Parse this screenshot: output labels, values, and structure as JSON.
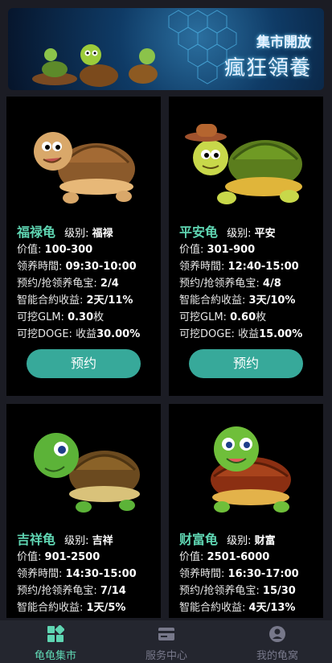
{
  "banner": {
    "line1": "集市開放",
    "line2": "瘋狂領養"
  },
  "cards": [
    {
      "name": "福禄龟",
      "level_label": "级别:",
      "level": "福禄",
      "rows": [
        {
          "label": "价值:",
          "value": "100-300"
        },
        {
          "label": "领养時間:",
          "value": "09:30-10:00"
        },
        {
          "label": "预约/抢领养龟宝:",
          "value": "2/4"
        },
        {
          "label": "智能合約收益:",
          "value": "2天/11%"
        },
        {
          "label": "可挖GLM:",
          "value": "0.30",
          "suffix": "枚"
        },
        {
          "label": "可挖DOGE:",
          "value": "30.00%",
          "prefix": "收益"
        }
      ],
      "button": "预约"
    },
    {
      "name": "平安龟",
      "level_label": "级别:",
      "level": "平安",
      "rows": [
        {
          "label": "价值:",
          "value": "301-900"
        },
        {
          "label": "领养時間:",
          "value": "12:40-15:00"
        },
        {
          "label": "预约/抢领养龟宝:",
          "value": "4/8"
        },
        {
          "label": "智能合約收益:",
          "value": "3天/10%"
        },
        {
          "label": "可挖GLM:",
          "value": "0.60",
          "suffix": "枚"
        },
        {
          "label": "可挖DOGE:",
          "value": "15.00%",
          "prefix": "收益"
        }
      ],
      "button": "预约"
    },
    {
      "name": "吉祥龟",
      "level_label": "级别:",
      "level": "吉祥",
      "rows": [
        {
          "label": "价值:",
          "value": "901-2500"
        },
        {
          "label": "领养時間:",
          "value": "14:30-15:00"
        },
        {
          "label": "预约/抢领养龟宝:",
          "value": "7/14"
        },
        {
          "label": "智能合約收益:",
          "value": "1天/5%"
        }
      ]
    },
    {
      "name": "财富龟",
      "level_label": "级别:",
      "level": "财富",
      "rows": [
        {
          "label": "价值:",
          "value": "2501-6000"
        },
        {
          "label": "领养時間:",
          "value": "16:30-17:00"
        },
        {
          "label": "预约/抢领养龟宝:",
          "value": "15/30"
        },
        {
          "label": "智能合約收益:",
          "value": "4天/13%"
        }
      ]
    }
  ],
  "tabs": [
    {
      "label": "龟龟集市",
      "icon": "grid-icon",
      "active": true
    },
    {
      "label": "服务中心",
      "icon": "card-icon",
      "active": false
    },
    {
      "label": "我的龟窝",
      "icon": "user-icon",
      "active": false
    }
  ],
  "colors": {
    "accent": "#5fd5b2",
    "button": "#37a99a",
    "card_bg": "#000000",
    "page_bg": "#1b1c24"
  }
}
